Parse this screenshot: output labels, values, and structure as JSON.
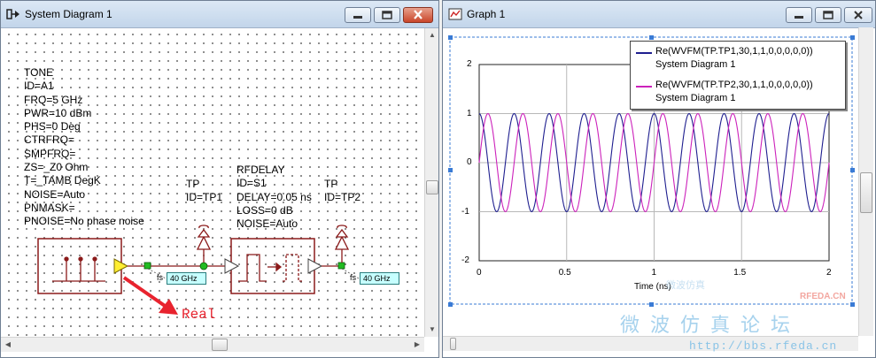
{
  "left_window": {
    "title": "System Diagram 1",
    "tone_params": [
      "TONE",
      "ID=A1",
      "FRQ=5 GHz",
      "PWR=10 dBm",
      "PHS=0 Deg",
      "CTRFRQ=",
      "SMPFRQ=",
      "ZS=_Z0 Ohm",
      "T=_TAMB DegK",
      "NOISE=Auto",
      "PNMASK=",
      "PNOISE=No phase noise"
    ],
    "tp1": {
      "name": "TP",
      "id": "ID=TP1"
    },
    "rfdelay_params": [
      "RFDELAY",
      "ID=S1",
      "DELAY=0.05 ns",
      "LOSS=0 dB",
      "NOISE=Auto"
    ],
    "tp2": {
      "name": "TP",
      "id": "ID=TP2"
    },
    "fs_tag": "fs",
    "fs1_value": "40 GHz",
    "fs2_value": "40 GHz",
    "annotation": "Real"
  },
  "right_window": {
    "title": "Graph 1",
    "legend": [
      {
        "name": "Re(WVFM(TP.TP1,30,1,1,0,0,0,0,0))",
        "source": "System Diagram 1",
        "color": "#1f1f8f"
      },
      {
        "name": "Re(WVFM(TP.TP2,30,1,1,0,0,0,0,0))",
        "source": "System Diagram 1",
        "color": "#cc22bb"
      }
    ]
  },
  "chart_data": {
    "type": "line",
    "xlabel": "Time (ns)",
    "ylabel": "",
    "xlim": [
      0,
      2
    ],
    "ylim": [
      -2,
      2
    ],
    "x_ticks": [
      "0",
      "0.5",
      "1",
      "1.5",
      "2"
    ],
    "y_ticks": [
      "2",
      "1",
      "0",
      "-1",
      "-2"
    ],
    "grid": true,
    "legend_position": "top-right",
    "series": [
      {
        "name": "Re(WVFM(TP.TP1,30,1,1,0,0,0,0,0))",
        "color": "#1f1f8f",
        "frequency_ghz": 5,
        "amplitude": 1,
        "phase_deg": 0
      },
      {
        "name": "Re(WVFM(TP.TP2,30,1,1,0,0,0,0,0))",
        "color": "#cc22bb",
        "frequency_ghz": 5,
        "amplitude": 1,
        "delay_ns": 0.05
      }
    ]
  },
  "watermark": {
    "brand": "RFEDA.CN",
    "chinese": "微波仿真论坛",
    "small": "微波仿真",
    "url": "http://bbs.rfeda.cn"
  }
}
